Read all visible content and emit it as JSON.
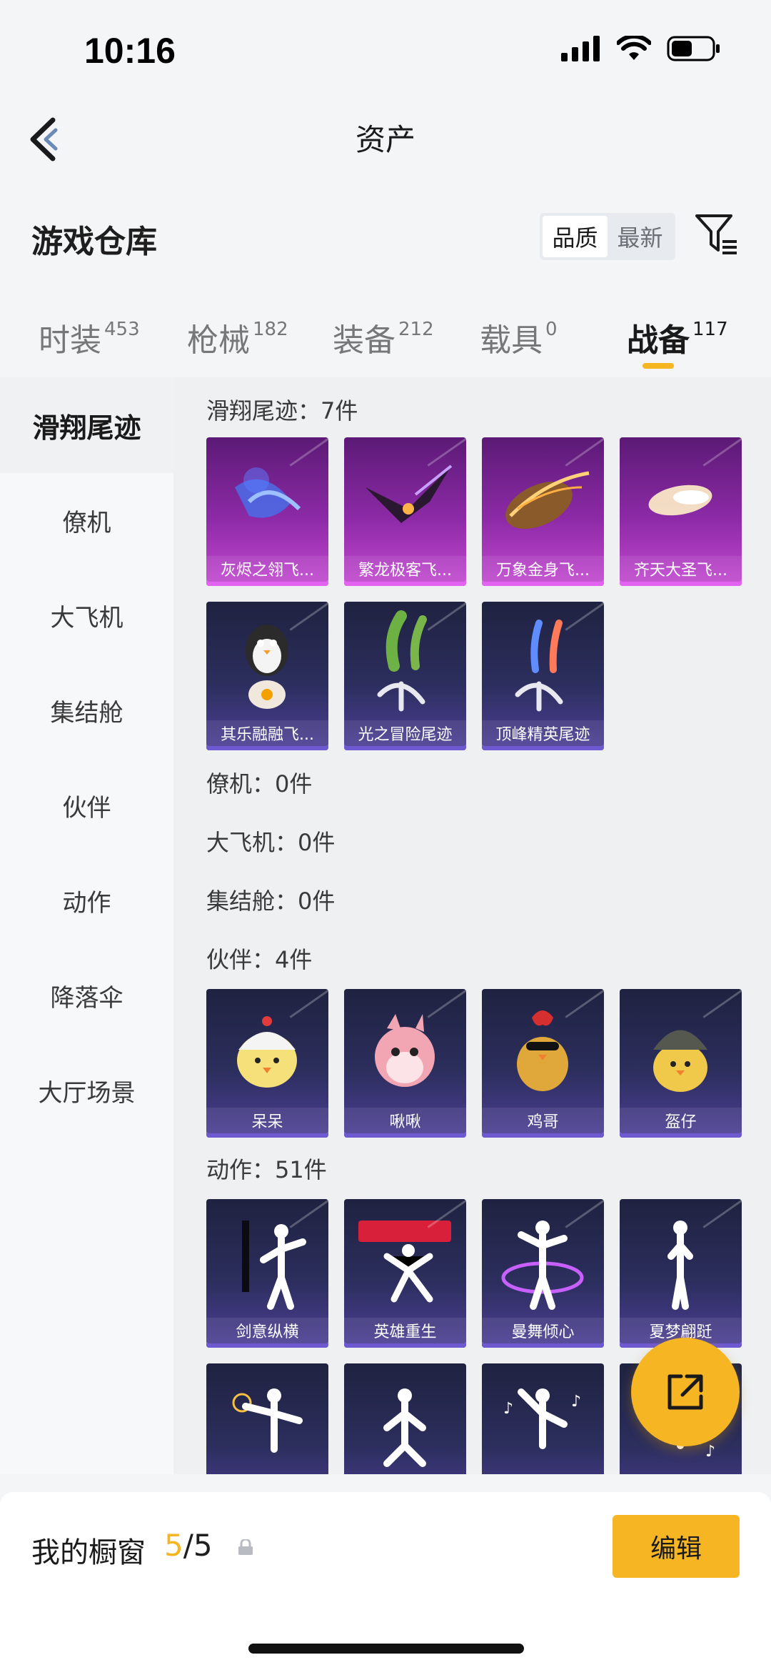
{
  "status": {
    "time": "10:16"
  },
  "nav": {
    "title": "资产"
  },
  "warehouse": {
    "title": "游戏仓库",
    "sort_options": [
      "品质",
      "最新"
    ]
  },
  "tabs": [
    {
      "label": "时装",
      "count": "453"
    },
    {
      "label": "枪械",
      "count": "182"
    },
    {
      "label": "装备",
      "count": "212"
    },
    {
      "label": "载具",
      "count": "0"
    },
    {
      "label": "战备",
      "count": "117"
    }
  ],
  "sidebar": {
    "items": [
      "滑翔尾迹",
      "僚机",
      "大飞机",
      "集结舱",
      "伙伴",
      "动作",
      "降落伞",
      "大厅场景"
    ]
  },
  "sections": {
    "glide": {
      "label": "滑翔尾迹：7件",
      "items": [
        "灰烬之翎飞...",
        "繁龙极客飞...",
        "万象金身飞...",
        "齐天大圣飞...",
        "其乐融融飞...",
        "光之冒险尾迹",
        "顶峰精英尾迹"
      ]
    },
    "wingman": {
      "label": "僚机：0件"
    },
    "plane": {
      "label": "大飞机：0件"
    },
    "pod": {
      "label": "集结舱：0件"
    },
    "partner": {
      "label": "伙伴：4件",
      "items": [
        "呆呆",
        "啾啾",
        "鸡哥",
        "盔仔"
      ]
    },
    "emote": {
      "label": "动作：51件",
      "items": [
        "剑意纵横",
        "英雄重生",
        "曼舞倾心",
        "夏梦翩跹"
      ]
    }
  },
  "bottom": {
    "showcase_label": "我的橱窗",
    "current": "5",
    "total": "/5",
    "edit_label": "编辑"
  },
  "colors": {
    "accent": "#f6b623",
    "legendary": "#c44ad1",
    "epic": "#4d3f97"
  }
}
